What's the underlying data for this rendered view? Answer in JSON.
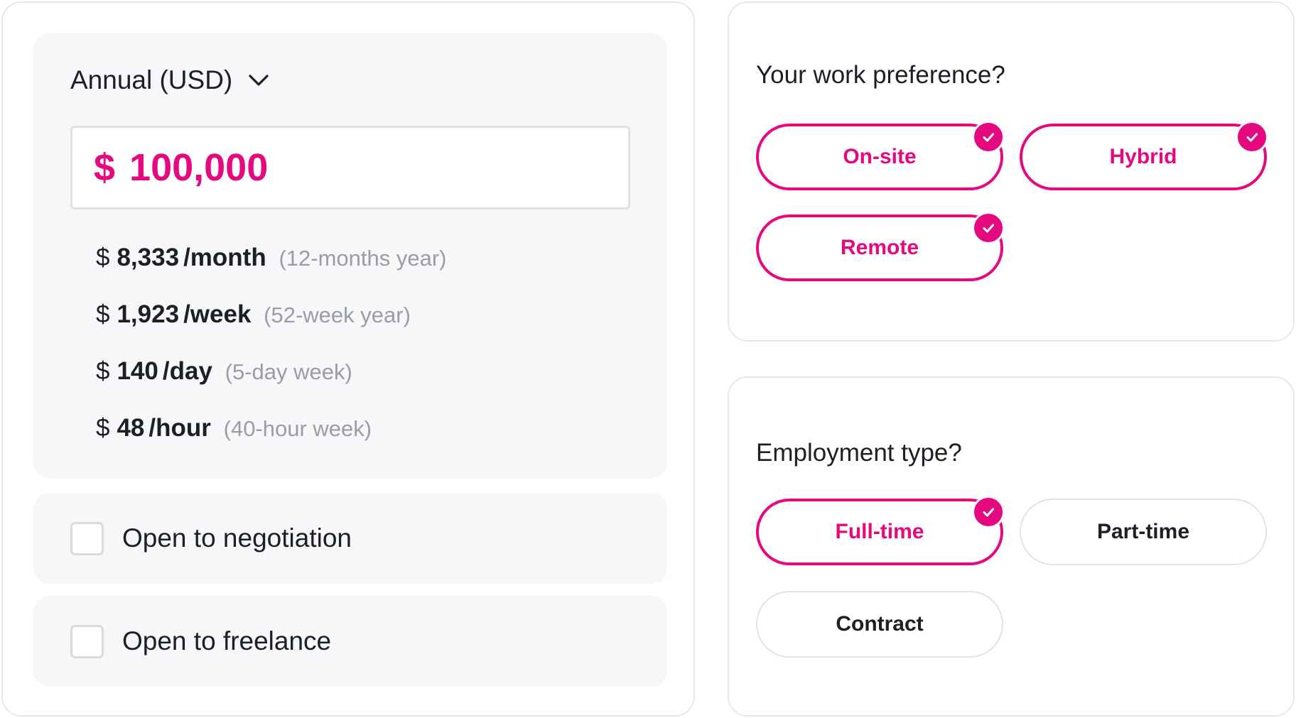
{
  "salary": {
    "period_label": "Annual (USD)",
    "currency_symbol": "$",
    "amount": "100,000",
    "breakdown": [
      {
        "symbol": "$",
        "value": "8,333",
        "per": "/month",
        "note": "(12-months year)"
      },
      {
        "symbol": "$",
        "value": "1,923",
        "per": "/week",
        "note": "(52-week year)"
      },
      {
        "symbol": "$",
        "value": "140",
        "per": "/day",
        "note": "(5-day week)"
      },
      {
        "symbol": "$",
        "value": "48",
        "per": "/hour",
        "note": "(40-hour week)"
      }
    ],
    "options": [
      {
        "label": "Open to negotiation",
        "checked": false
      },
      {
        "label": "Open to freelance",
        "checked": false
      }
    ]
  },
  "work_preference": {
    "question": "Your work preference?",
    "options": [
      {
        "label": "On-site",
        "selected": true
      },
      {
        "label": "Hybrid",
        "selected": true
      },
      {
        "label": "Remote",
        "selected": true
      }
    ]
  },
  "employment_type": {
    "question": "Employment type?",
    "options": [
      {
        "label": "Full-time",
        "selected": true
      },
      {
        "label": "Part-time",
        "selected": false
      },
      {
        "label": "Contract",
        "selected": false
      }
    ]
  },
  "colors": {
    "accent": "#e5087e",
    "text": "#1c1f26",
    "muted": "#9a9da3",
    "panel": "#f6f7f9",
    "border": "#e7e8ea"
  },
  "icons": {
    "dropdown": "chevron-down-icon",
    "selected": "check-icon"
  }
}
